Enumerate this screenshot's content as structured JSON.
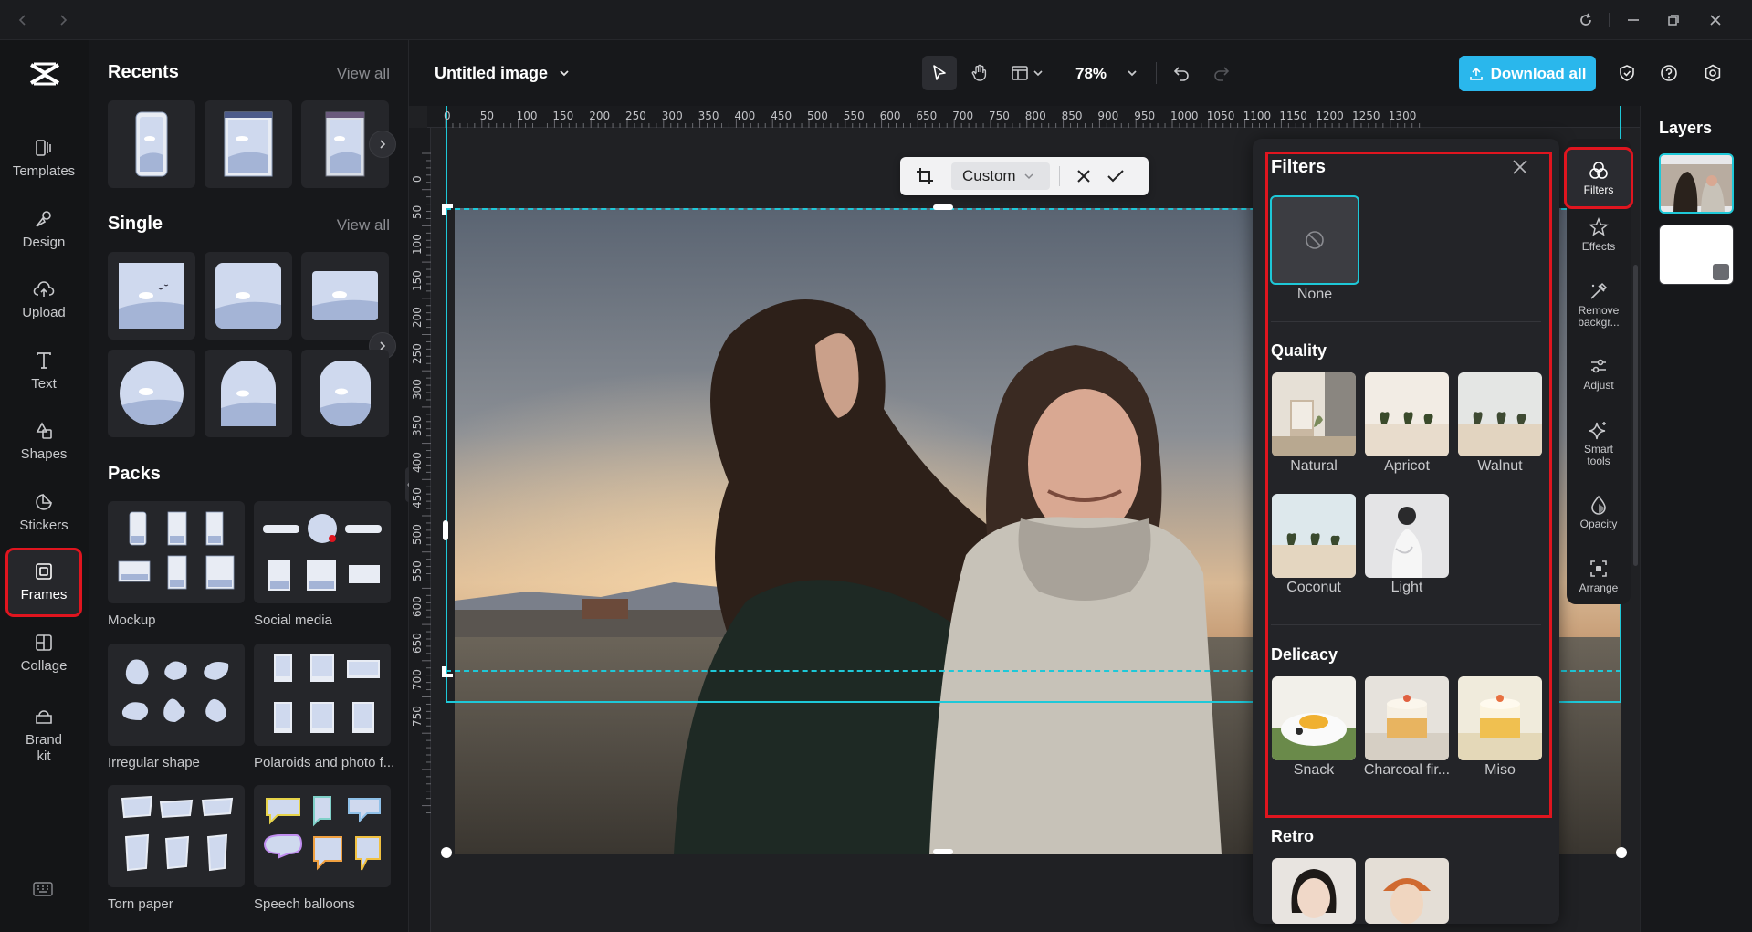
{
  "window": {
    "back_icon": "chevron-left-icon",
    "forward_icon": "chevron-right-icon",
    "controls": [
      "refresh-icon",
      "minimize-icon",
      "restore-icon",
      "close-icon"
    ]
  },
  "nav": {
    "items": [
      {
        "label": "Templates",
        "icon": "templates-icon"
      },
      {
        "label": "Design",
        "icon": "design-icon"
      },
      {
        "label": "Upload",
        "icon": "upload-cloud-icon"
      },
      {
        "label": "Text",
        "icon": "text-icon"
      },
      {
        "label": "Shapes",
        "icon": "shapes-icon"
      },
      {
        "label": "Stickers",
        "icon": "stickers-icon"
      },
      {
        "label": "Frames",
        "icon": "frames-icon"
      },
      {
        "label": "Collage",
        "icon": "collage-icon"
      },
      {
        "label": "Brand\nkit",
        "icon": "brand-kit-icon"
      }
    ],
    "active": "Frames"
  },
  "assets": {
    "recents_title": "Recents",
    "single_title": "Single",
    "packs_title": "Packs",
    "view_all": "View all",
    "packs": [
      "Mockup",
      "Social media",
      "Irregular shape",
      "Polaroids and photo f...",
      "Torn paper",
      "Speech balloons"
    ]
  },
  "toolbar": {
    "document_title": "Untitled image",
    "zoom": "78%",
    "download_label": "Download all"
  },
  "crop_bar": {
    "ratio": "Custom"
  },
  "ruler": {
    "top": [
      "0",
      "50",
      "100",
      "150",
      "200",
      "250",
      "300",
      "350",
      "400",
      "450",
      "500",
      "550",
      "600",
      "650",
      "700",
      "750",
      "800",
      "850",
      "900",
      "950",
      "1000",
      "1050",
      "1100",
      "1150",
      "1200",
      "1250",
      "1300"
    ],
    "left": [
      "0",
      "50",
      "100",
      "150",
      "200",
      "250",
      "300",
      "350",
      "400",
      "450",
      "500",
      "550",
      "600",
      "650",
      "700",
      "750"
    ]
  },
  "filters": {
    "title": "Filters",
    "none_label": "None",
    "quality_title": "Quality",
    "quality": [
      "Natural",
      "Apricot",
      "Walnut",
      "Coconut",
      "Light"
    ],
    "delicacy_title": "Delicacy",
    "delicacy": [
      "Snack",
      "Charcoal fir...",
      "Miso"
    ],
    "retro_title": "Retro"
  },
  "right_tools": [
    {
      "label": "Filters",
      "icon": "filters-icon"
    },
    {
      "label": "Effects",
      "icon": "effects-icon"
    },
    {
      "label": "Remove\nbackgr...",
      "icon": "remove-background-icon"
    },
    {
      "label": "Adjust",
      "icon": "adjust-icon"
    },
    {
      "label": "Smart\ntools",
      "icon": "smart-tools-icon"
    },
    {
      "label": "Opacity",
      "icon": "opacity-icon"
    },
    {
      "label": "Arrange",
      "icon": "arrange-icon"
    }
  ],
  "layers": {
    "title": "Layers"
  },
  "colors": {
    "accent": "#2ab7ec",
    "selection": "#1ec8d8",
    "highlight": "#e0151f"
  }
}
